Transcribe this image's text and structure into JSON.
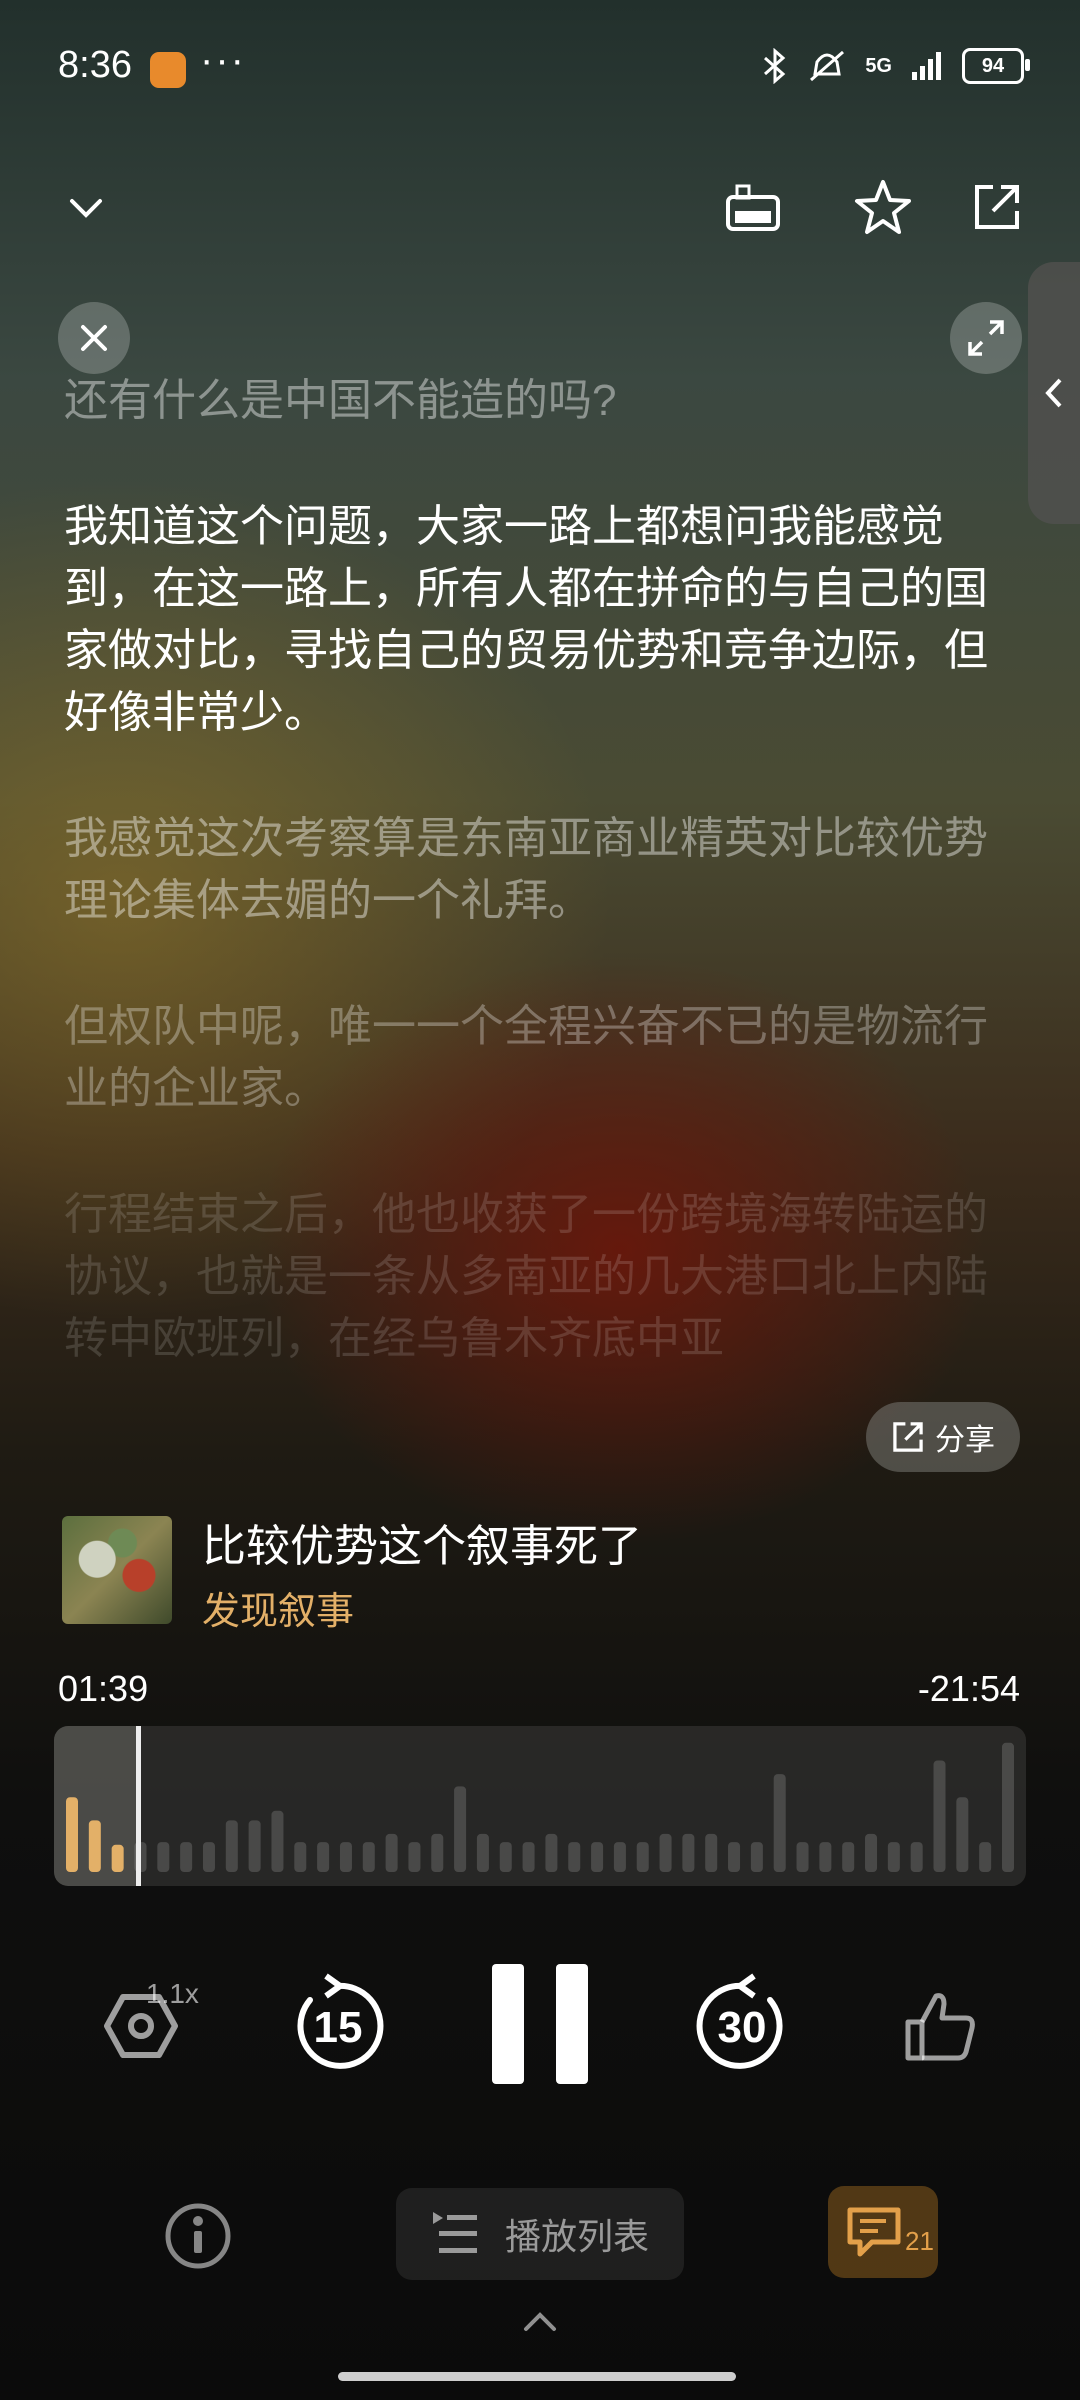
{
  "status_bar": {
    "time": "8:36",
    "more_dots": "···",
    "network": "5G",
    "battery": "94",
    "icons": [
      "app-badge-icon",
      "bluetooth-icon",
      "mute-icon",
      "signal-icon",
      "battery-icon"
    ]
  },
  "top_bar": {
    "icons": [
      "chevron-down-icon",
      "subtitle-icon",
      "star-icon",
      "share-icon"
    ]
  },
  "transcript": {
    "paragraphs": [
      "还有什么是中国不能造的吗?",
      "我知道这个问题，大家一路上都想问我能感觉到，在这一路上，所有人都在拼命的与自己的国家做对比，寻找自己的贸易优势和竞争边际，但好像非常少。",
      "我感觉这次考察算是东南亚商业精英对比较优势理论集体去媚的一个礼拜。",
      "但权队中呢，唯一一个全程兴奋不已的是物流行业的企业家。",
      "行程结束之后，他也收获了一份跨境海转陆运的协议，也就是一条从多南亚的几大港口北上内陆转中欧班列，在经乌鲁木齐底中亚"
    ],
    "share_label": "分享"
  },
  "now_playing": {
    "title": "比较优势这个叙事死了",
    "podcast": "发现叙事",
    "elapsed": "01:39",
    "remaining": "-21:54",
    "progress": 0.07
  },
  "controls": {
    "speed": "1.1x",
    "rewind_seconds": "15",
    "forward_seconds": "30",
    "state": "playing"
  },
  "bottom_bar": {
    "playlist_label": "播放列表",
    "comment_count": "21"
  },
  "colors": {
    "accent_gold": "#e3b068",
    "comment_accent": "#e3a04a"
  },
  "waveform": {
    "played_bars": [
      0.55,
      0.38,
      0.2
    ],
    "bars": [
      0.22,
      0.22,
      0.22,
      0.22,
      0.38,
      0.38,
      0.45,
      0.22,
      0.22,
      0.22,
      0.22,
      0.28,
      0.22,
      0.28,
      0.63,
      0.28,
      0.22,
      0.22,
      0.28,
      0.22,
      0.22,
      0.22,
      0.22,
      0.28,
      0.28,
      0.28,
      0.22,
      0.22,
      0.72,
      0.22,
      0.22,
      0.22,
      0.28,
      0.22,
      0.22,
      0.82,
      0.55,
      0.22,
      0.95
    ]
  }
}
